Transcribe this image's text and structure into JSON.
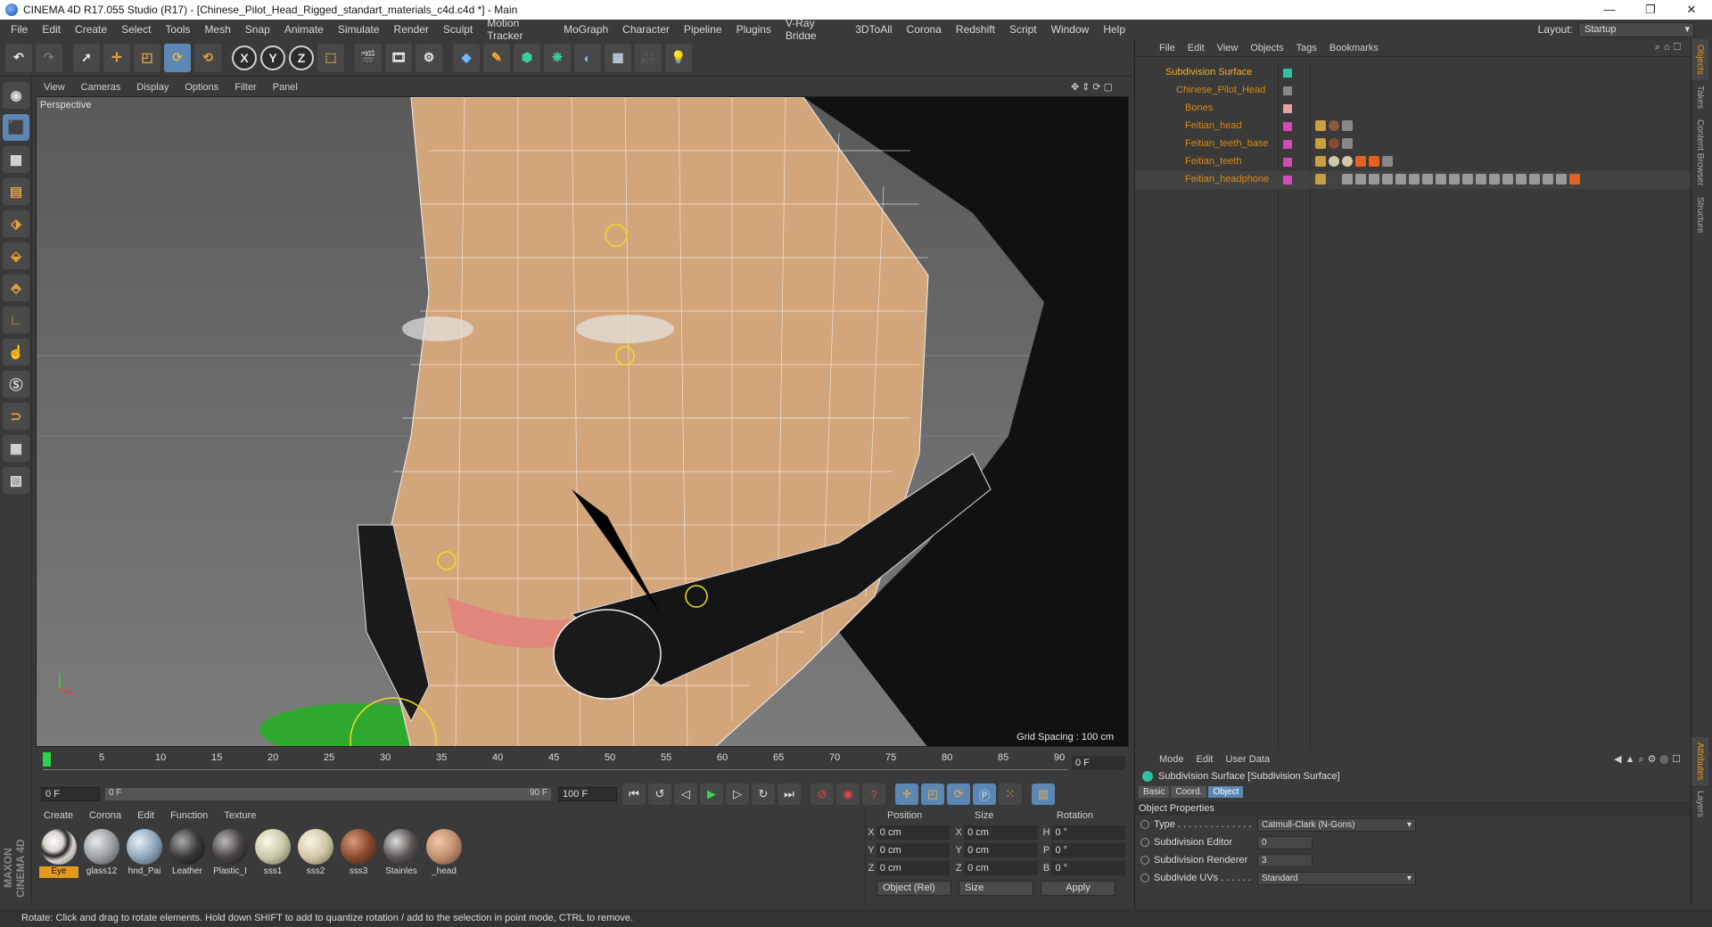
{
  "window": {
    "title": "CINEMA 4D R17.055 Studio (R17) - [Chinese_Pilot_Head_Rigged_standart_materials_c4d.c4d *] - Main",
    "minimize": "—",
    "maximize": "❐",
    "close": "✕"
  },
  "menu": [
    "File",
    "Edit",
    "Create",
    "Select",
    "Tools",
    "Mesh",
    "Snap",
    "Animate",
    "Simulate",
    "Render",
    "Sculpt",
    "Motion Tracker",
    "MoGraph",
    "Character",
    "Pipeline",
    "Plugins",
    "V-Ray Bridge",
    "3DToAll",
    "Corona",
    "Redshift",
    "Script",
    "Window",
    "Help"
  ],
  "layout": {
    "label": "Layout:",
    "value": "Startup"
  },
  "toolbar": {
    "axis_x": "X",
    "axis_y": "Y",
    "axis_z": "Z"
  },
  "viewport": {
    "menu": [
      "View",
      "Cameras",
      "Display",
      "Options",
      "Filter",
      "Panel"
    ],
    "label": "Perspective",
    "grid_spacing": "Grid Spacing : 100 cm"
  },
  "timeline": {
    "ticks": [
      "0",
      "5",
      "10",
      "15",
      "20",
      "25",
      "30",
      "35",
      "40",
      "45",
      "50",
      "55",
      "60",
      "65",
      "70",
      "75",
      "80",
      "85",
      "90"
    ],
    "current_frame": "0 F",
    "start": "0 F",
    "range_start": "0 F",
    "range_end": "90 F",
    "end": "100 F"
  },
  "materials": {
    "menu": [
      "Create",
      "Corona",
      "Edit",
      "Function",
      "Texture"
    ],
    "items": [
      {
        "label": "Eye",
        "color": "#d8d4cc"
      },
      {
        "label": "glass12",
        "color": "#9aa0a6"
      },
      {
        "label": "hnd_Pai",
        "color": "#8fa6b8"
      },
      {
        "label": "Leather",
        "color": "#3a3836"
      },
      {
        "label": "Plastic_I",
        "color": "#4a4442"
      },
      {
        "label": "sss1",
        "color": "#c8c8a8"
      },
      {
        "label": "sss2",
        "color": "#d2c8a8"
      },
      {
        "label": "sss3",
        "color": "#8a4a30"
      },
      {
        "label": "Stainles",
        "color": "#5a5654"
      },
      {
        "label": "_head",
        "color": "#c09070"
      }
    ]
  },
  "coords": {
    "headers": [
      "Position",
      "Size",
      "Rotation"
    ],
    "rows": [
      {
        "a": "X",
        "p": "0 cm",
        "b": "X",
        "s": "0 cm",
        "c": "H",
        "r": "0 °"
      },
      {
        "a": "Y",
        "p": "0 cm",
        "b": "Y",
        "s": "0 cm",
        "c": "P",
        "r": "0 °"
      },
      {
        "a": "Z",
        "p": "0 cm",
        "b": "Z",
        "s": "0 cm",
        "c": "B",
        "r": "0 °"
      }
    ],
    "mode": "Object (Rel)",
    "size_mode": "Size",
    "apply": "Apply"
  },
  "status": "Rotate: Click and drag to rotate elements. Hold down SHIFT to add to quantize rotation / add to the selection in point mode, CTRL to remove.",
  "maxon": "MAXON CINEMA 4D",
  "object_manager": {
    "menu": [
      "File",
      "Edit",
      "View",
      "Objects",
      "Tags",
      "Bookmarks"
    ],
    "rows": [
      {
        "name": "Subdivision Surface",
        "indent": 0
      },
      {
        "name": "Chinese_Pilot_Head",
        "indent": 1
      },
      {
        "name": "Bones",
        "indent": 2
      },
      {
        "name": "Feitian_head",
        "indent": 2
      },
      {
        "name": "Feitian_teeth_base",
        "indent": 2
      },
      {
        "name": "Feitian_teeth",
        "indent": 2
      },
      {
        "name": "Feitian_headphone",
        "indent": 2
      }
    ]
  },
  "side_tabs": [
    "Objects",
    "Takes",
    "Content Browser",
    "Structure"
  ],
  "side_tabs_bottom": [
    "Attributes",
    "Layers"
  ],
  "attributes": {
    "menu": [
      "Mode",
      "Edit",
      "User Data"
    ],
    "title": "Subdivision Surface [Subdivision Surface]",
    "tabs": [
      "Basic",
      "Coord.",
      "Object"
    ],
    "section": "Object Properties",
    "rows": [
      {
        "label": "Type . . . . . . . . . . . . . .",
        "value": "Catmull-Clark (N-Gons)"
      },
      {
        "label": "Subdivision Editor",
        "value": "0"
      },
      {
        "label": "Subdivision Renderer",
        "value": "3"
      },
      {
        "label": "Subdivide UVs . . . . . .",
        "value": "Standard"
      }
    ]
  }
}
